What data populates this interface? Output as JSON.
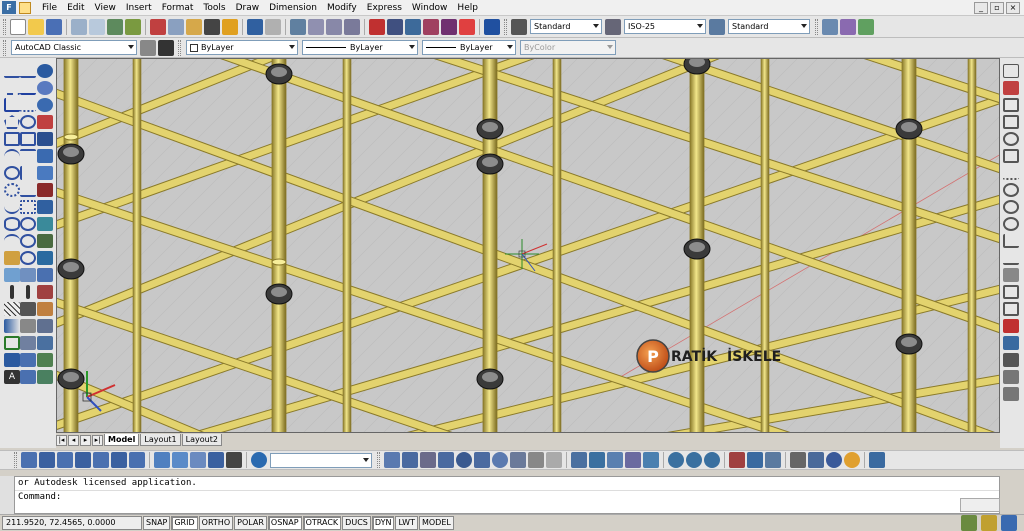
{
  "menubar": {
    "items": [
      "File",
      "Edit",
      "View",
      "Insert",
      "Format",
      "Tools",
      "Draw",
      "Dimension",
      "Modify",
      "Express",
      "Window",
      "Help"
    ]
  },
  "toolbar_top": {
    "text_style": "Standard",
    "dim_style": "ISO-25",
    "table_style": "Standard"
  },
  "toolbar_props": {
    "workspace": "AutoCAD Classic",
    "layer": "ByLayer",
    "linetype": "ByLayer",
    "lineweight": "ByLayer",
    "plot_style": "ByColor"
  },
  "tabs": {
    "items": [
      "Model",
      "Layout1",
      "Layout2"
    ],
    "active": "Model"
  },
  "watermark": {
    "letter": "P",
    "word1": "RATİK",
    "word2": "İSKELE"
  },
  "command": {
    "history": "or Autodesk licensed application.",
    "prompt": "Command:"
  },
  "status": {
    "coordinates": "211.9520, 72.4565, 0.0000",
    "toggles": [
      "SNAP",
      "GRID",
      "ORTHO",
      "POLAR",
      "OSNAP",
      "OTRACK",
      "DUCS",
      "DYN",
      "LWT",
      "MODEL"
    ]
  },
  "colors": {
    "pipe": "#e3d36e",
    "pipe_shadow": "#8a7a2a",
    "canvas": "#c8c8c8",
    "brand_orange": "#e8761e"
  }
}
